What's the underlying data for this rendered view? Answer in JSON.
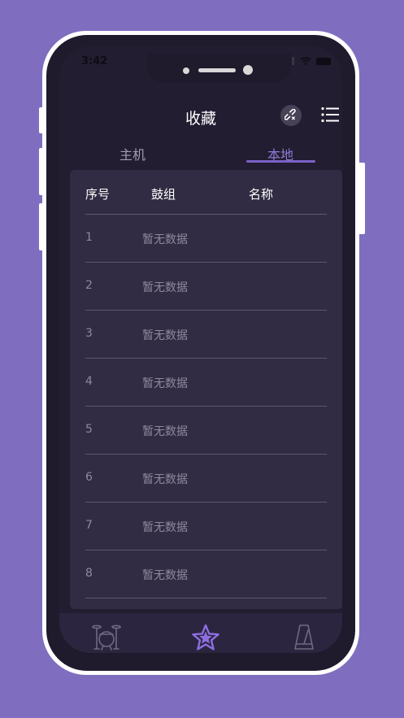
{
  "status": {
    "time": "3:42"
  },
  "header": {
    "title": "收藏",
    "link_icon": "unlink-icon",
    "menu_icon": "menu-icon"
  },
  "tabs": [
    {
      "label": "主机",
      "active": false
    },
    {
      "label": "本地",
      "active": true
    }
  ],
  "table": {
    "columns": [
      "序号",
      "鼓组",
      "名称"
    ],
    "rows": [
      {
        "index": "1",
        "kit": "暂无数据"
      },
      {
        "index": "2",
        "kit": "暂无数据"
      },
      {
        "index": "3",
        "kit": "暂无数据"
      },
      {
        "index": "4",
        "kit": "暂无数据"
      },
      {
        "index": "5",
        "kit": "暂无数据"
      },
      {
        "index": "6",
        "kit": "暂无数据"
      },
      {
        "index": "7",
        "kit": "暂无数据"
      },
      {
        "index": "8",
        "kit": "暂无数据"
      }
    ]
  },
  "bottom_nav": [
    {
      "icon": "drum-kit-icon",
      "active": false
    },
    {
      "icon": "star-icon",
      "active": true
    },
    {
      "icon": "metronome-icon",
      "active": false
    }
  ],
  "colors": {
    "background": "#7f6ebf",
    "accent": "#8d7bd4",
    "screen": "#231d31",
    "card": "#312c43"
  }
}
